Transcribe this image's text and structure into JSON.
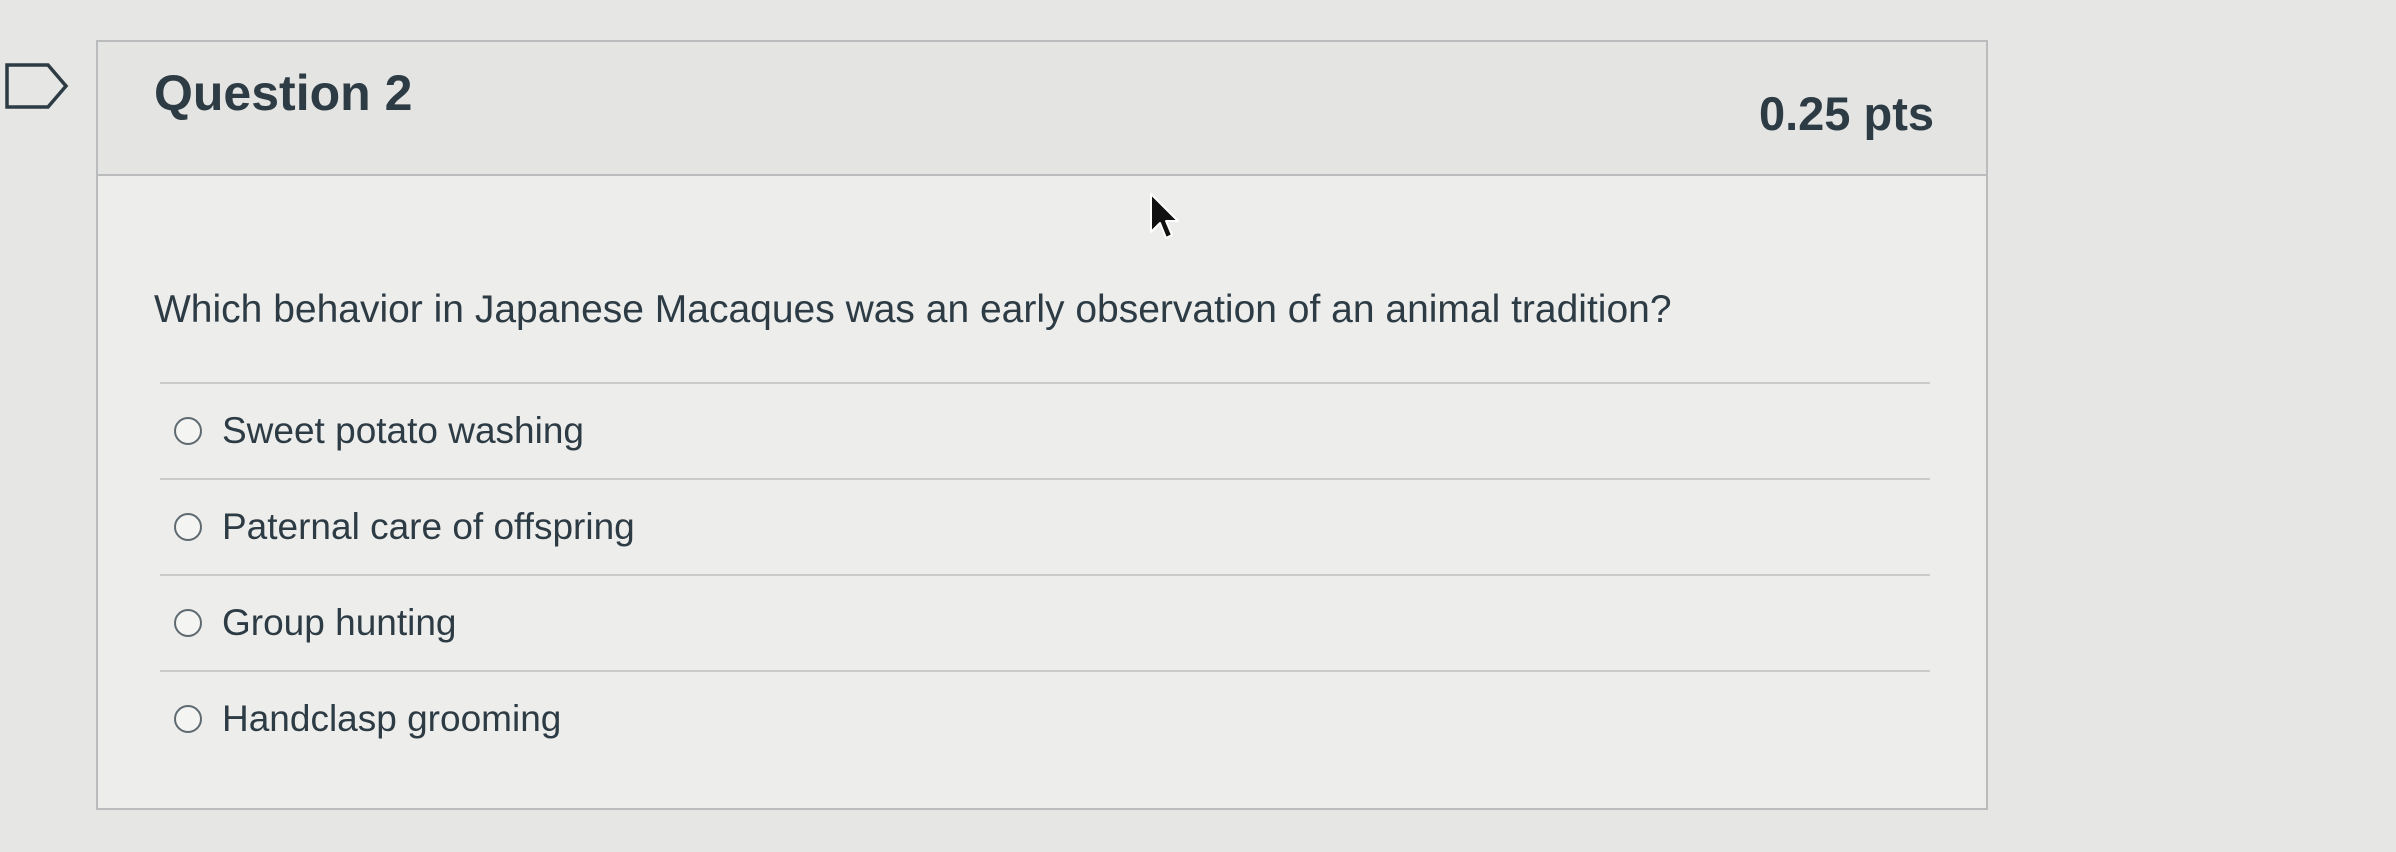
{
  "question": {
    "title": "Question 2",
    "points": "0.25 pts",
    "text": "Which behavior in Japanese Macaques was an early observation of an animal tradition?",
    "answers": [
      {
        "label": "Sweet potato washing",
        "selected": false
      },
      {
        "label": "Paternal care of offspring",
        "selected": false
      },
      {
        "label": "Group hunting",
        "selected": false
      },
      {
        "label": "Handclasp grooming",
        "selected": false
      }
    ]
  },
  "icons": {
    "flag": "flag-outline-icon",
    "cursor": "mouse-pointer-icon"
  },
  "colors": {
    "text": "#2d3b45",
    "border": "#b9bbbc",
    "background": "#e6e6e4"
  }
}
